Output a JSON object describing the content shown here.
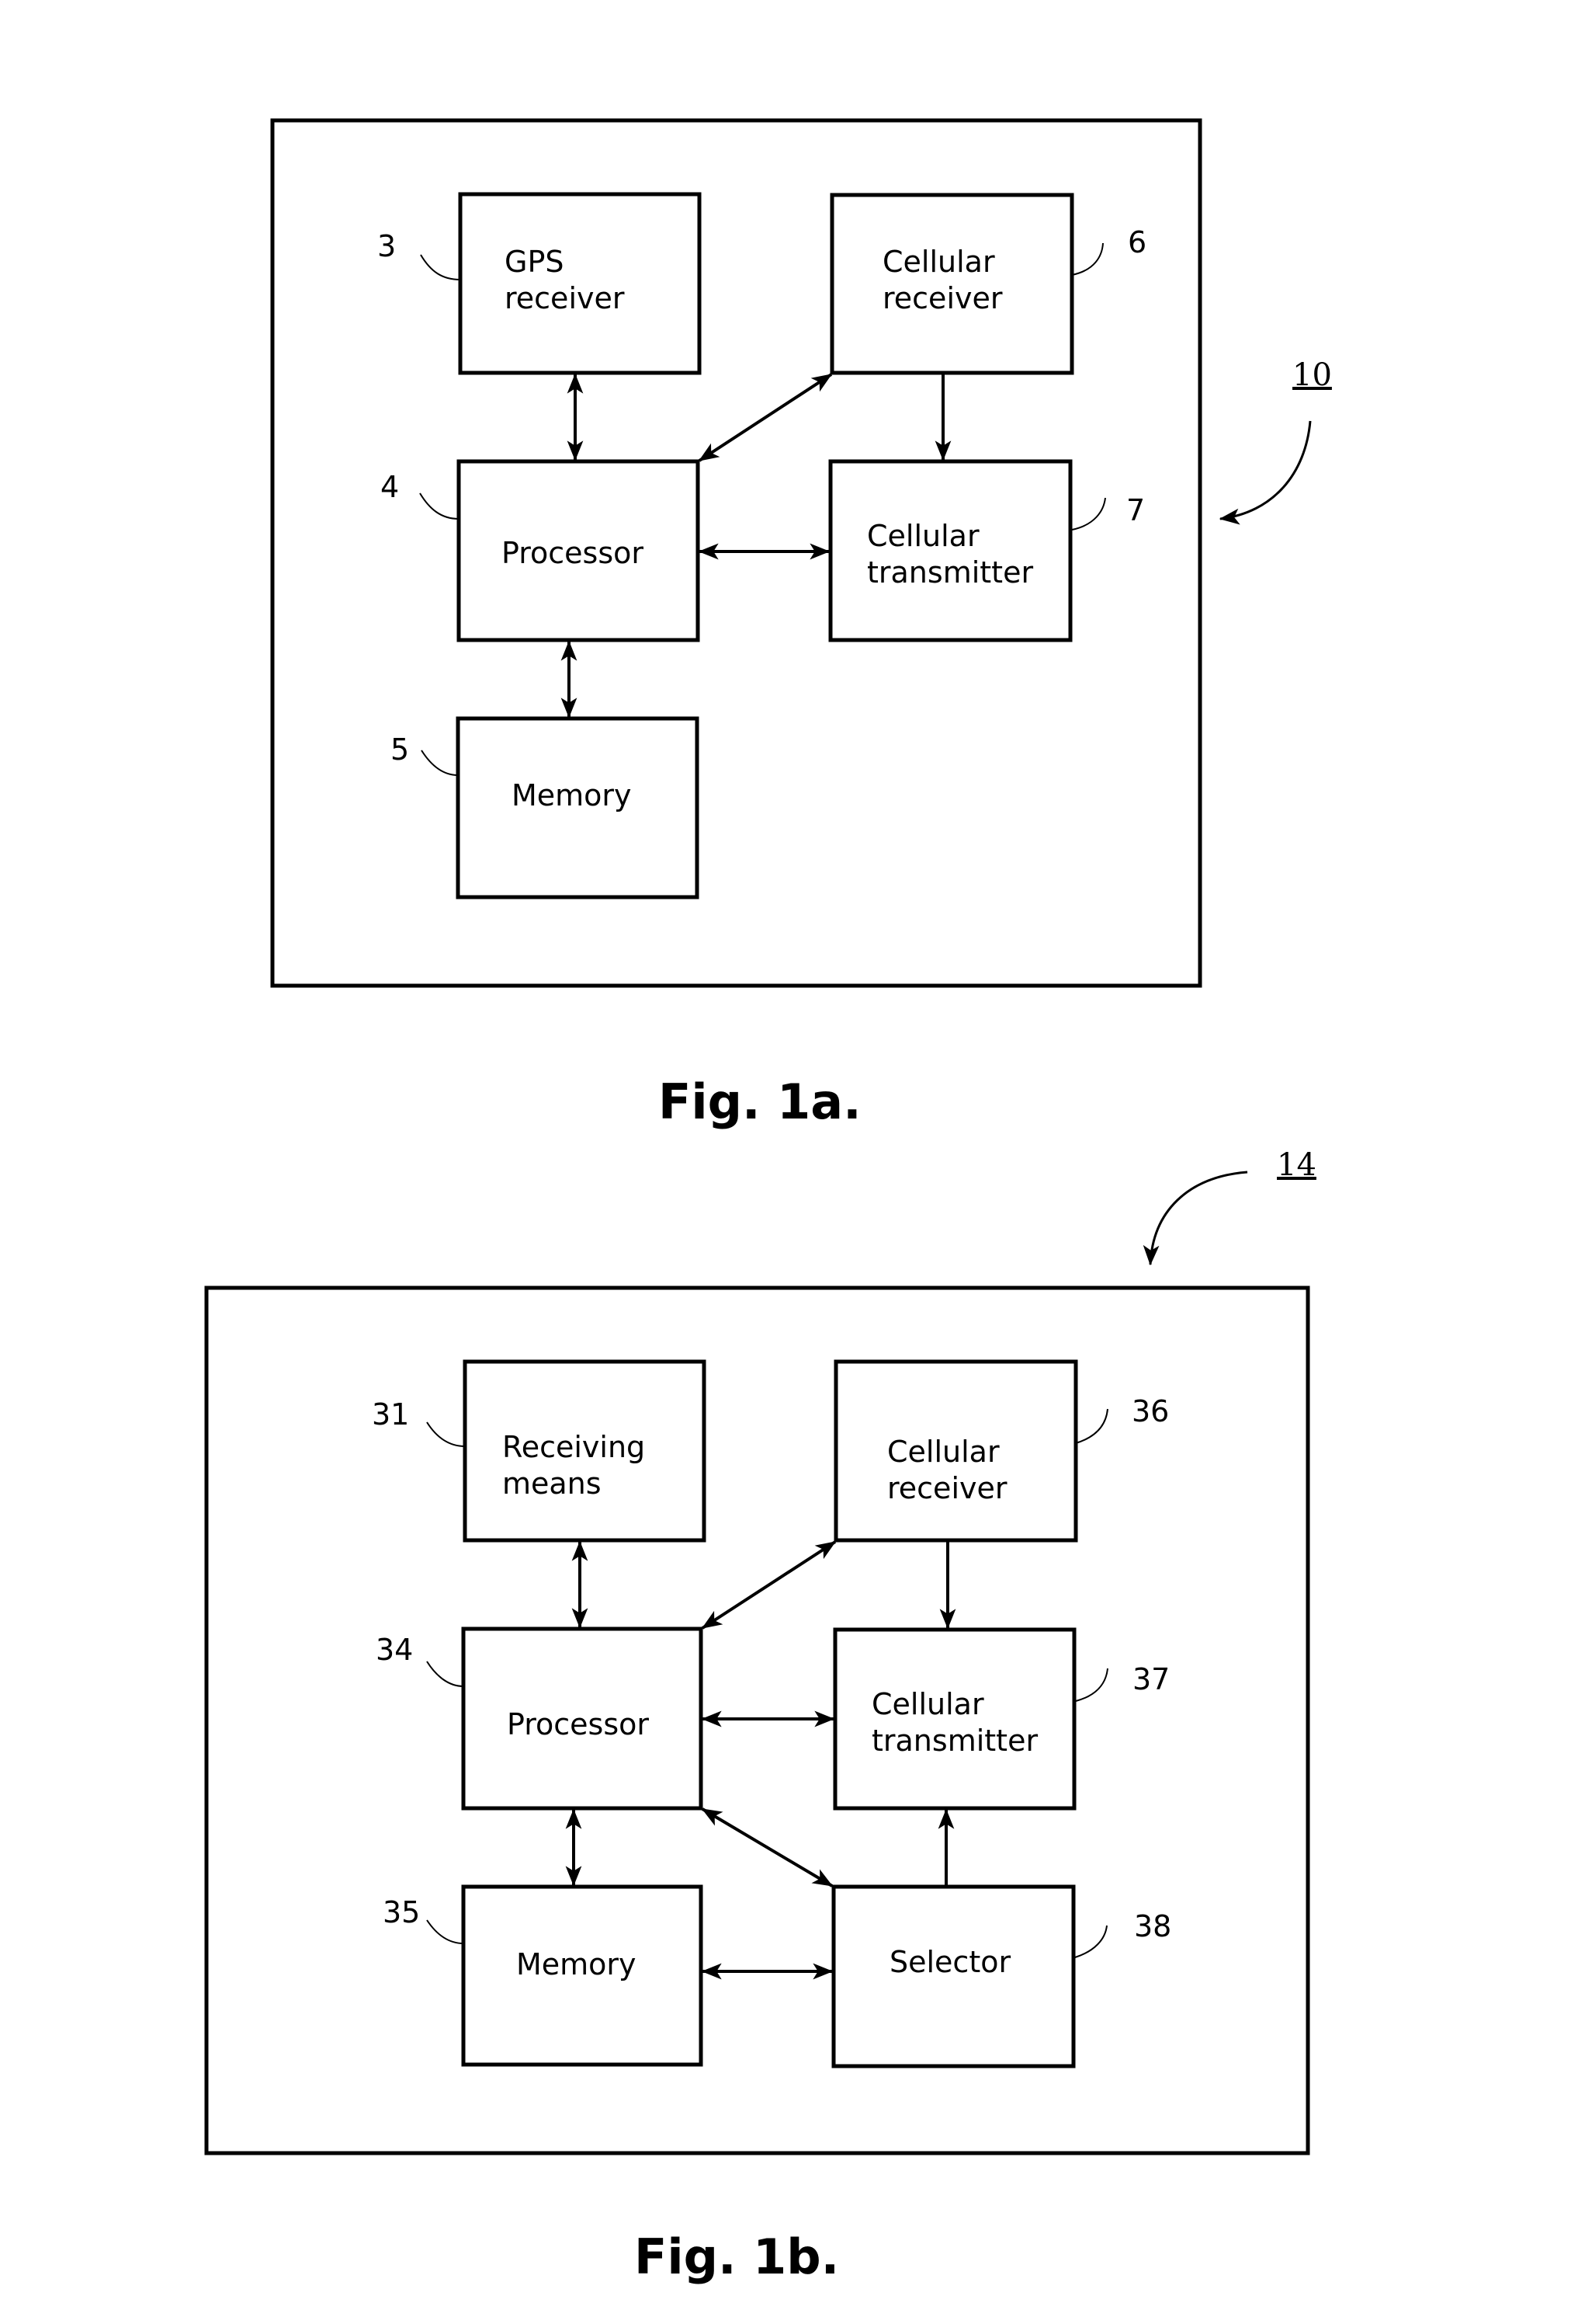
{
  "figures": {
    "fig1a": {
      "caption": "Fig. 1a.",
      "device_ref": "10",
      "blocks": {
        "gps": {
          "ref": "3",
          "lines": [
            "GPS",
            "receiver"
          ]
        },
        "processor": {
          "ref": "4",
          "lines": [
            "Processor"
          ]
        },
        "memory": {
          "ref": "5",
          "lines": [
            "Memory"
          ]
        },
        "cellular_receiver": {
          "ref": "6",
          "lines": [
            "Cellular",
            "receiver"
          ]
        },
        "cellular_transmitter": {
          "ref": "7",
          "lines": [
            "Cellular",
            "transmitter"
          ]
        }
      },
      "connections": [
        {
          "from": "gps",
          "to": "processor",
          "type": "bidirectional"
        },
        {
          "from": "processor",
          "to": "cellular_receiver",
          "type": "bidirectional"
        },
        {
          "from": "cellular_receiver",
          "to": "cellular_transmitter",
          "type": "directed"
        },
        {
          "from": "processor",
          "to": "cellular_transmitter",
          "type": "bidirectional"
        },
        {
          "from": "processor",
          "to": "memory",
          "type": "bidirectional"
        }
      ]
    },
    "fig1b": {
      "caption": "Fig. 1b.",
      "device_ref": "14",
      "blocks": {
        "receiving_means": {
          "ref": "31",
          "lines": [
            "Receiving",
            "means"
          ]
        },
        "processor": {
          "ref": "34",
          "lines": [
            "Processor"
          ]
        },
        "memory": {
          "ref": "35",
          "lines": [
            "Memory"
          ]
        },
        "cellular_receiver": {
          "ref": "36",
          "lines": [
            "Cellular",
            "receiver"
          ]
        },
        "cellular_transmitter": {
          "ref": "37",
          "lines": [
            "Cellular",
            "transmitter"
          ]
        },
        "selector": {
          "ref": "38",
          "lines": [
            "Selector"
          ]
        }
      },
      "connections": [
        {
          "from": "receiving_means",
          "to": "processor",
          "type": "bidirectional"
        },
        {
          "from": "processor",
          "to": "cellular_receiver",
          "type": "bidirectional"
        },
        {
          "from": "cellular_receiver",
          "to": "cellular_transmitter",
          "type": "directed"
        },
        {
          "from": "processor",
          "to": "cellular_transmitter",
          "type": "bidirectional"
        },
        {
          "from": "processor",
          "to": "selector",
          "type": "bidirectional"
        },
        {
          "from": "selector",
          "to": "cellular_transmitter",
          "type": "directed"
        },
        {
          "from": "processor",
          "to": "memory",
          "type": "bidirectional"
        },
        {
          "from": "memory",
          "to": "selector",
          "type": "bidirectional"
        }
      ]
    }
  }
}
